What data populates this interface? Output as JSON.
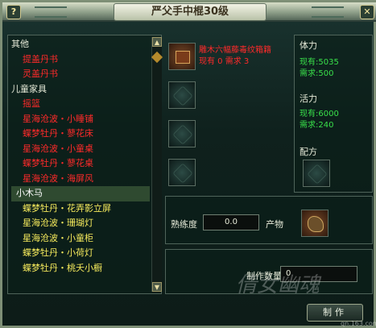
{
  "window": {
    "title": "严父手中棍30级",
    "help_label": "?",
    "close_label": "✕"
  },
  "recipe_tree": {
    "items": [
      {
        "label": "其他",
        "kind": "cat"
      },
      {
        "label": "提盖丹书",
        "kind": "red"
      },
      {
        "label": "灵盖丹书",
        "kind": "red"
      },
      {
        "label": "儿童家具",
        "kind": "cat"
      },
      {
        "label": "摇篮",
        "kind": "red"
      },
      {
        "label": "星海沧波・小睡铺",
        "kind": "red"
      },
      {
        "label": "蝶梦牡丹・蓼花床",
        "kind": "red"
      },
      {
        "label": "星海沧波・小童桌",
        "kind": "red"
      },
      {
        "label": "蝶梦牡丹・蓼花桌",
        "kind": "red"
      },
      {
        "label": "星海沧波・海屏风",
        "kind": "red"
      },
      {
        "label": "小木马",
        "kind": "selected"
      },
      {
        "label": "蝶梦牡丹・花弄影立屏",
        "kind": "yellow"
      },
      {
        "label": "星海沧波・珊瑚灯",
        "kind": "yellow"
      },
      {
        "label": "星海沧波・小童柜",
        "kind": "yellow"
      },
      {
        "label": "蝶梦牡丹・小荷灯",
        "kind": "yellow"
      },
      {
        "label": "蝶梦牡丹・桃夭小橱",
        "kind": "yellow"
      }
    ]
  },
  "materials": {
    "first": {
      "name": "雕木六幅藤毒纹箱籍",
      "stock": "现有 0  需求 3"
    }
  },
  "stats": {
    "stamina": {
      "label": "体力",
      "current": "现有:5035",
      "required": "需求:500"
    },
    "vitality": {
      "label": "活力",
      "current": "现有:6000",
      "required": "需求:240"
    },
    "formula_label": "配方"
  },
  "proficiency": {
    "label": "熟练度",
    "value": "0.0",
    "product_label": "产物"
  },
  "make": {
    "quantity_label": "制作数量",
    "quantity_value": "0",
    "button_label": "制作"
  },
  "watermark": {
    "brand": "倩女幽魂",
    "url": "qn.163.com"
  },
  "colors": {
    "unavailable": "#ff2a2a",
    "available": "#f6ea5c",
    "stat_value": "#39e04a"
  }
}
